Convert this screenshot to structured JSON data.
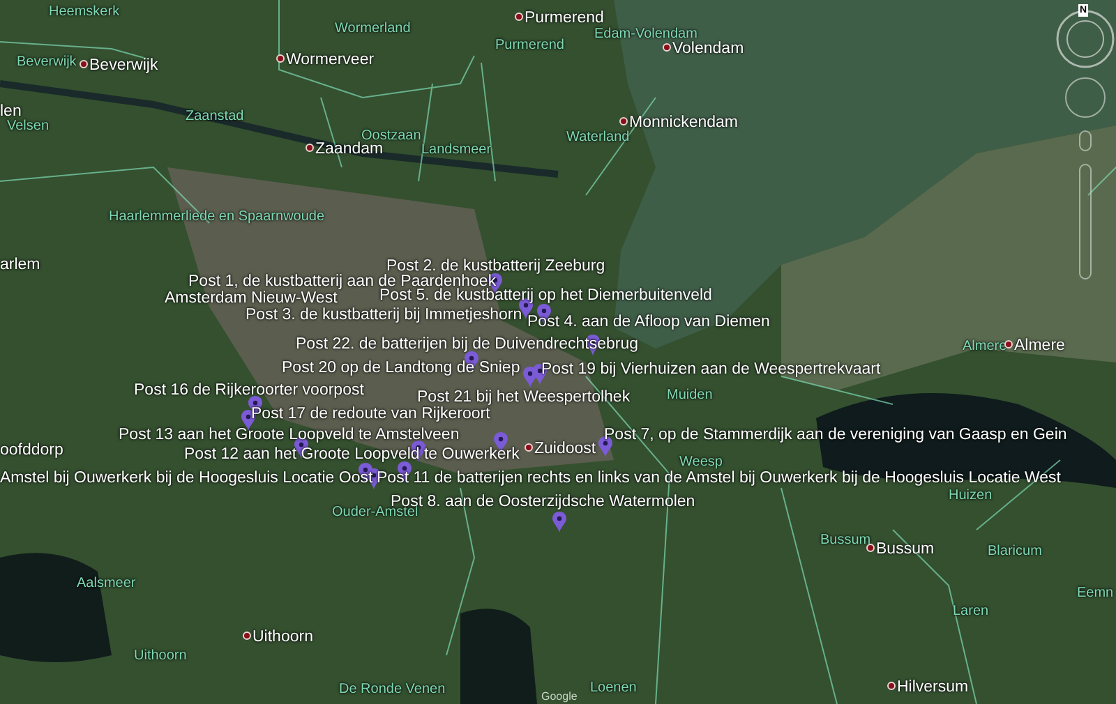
{
  "places": [
    {
      "name": "Heemskerk",
      "kind": "area"
    },
    {
      "name": "Beverwijk",
      "kind": "area"
    },
    {
      "name": "Beverwijk",
      "kind": "town"
    },
    {
      "name": "len",
      "kind": "town"
    },
    {
      "name": "Velsen",
      "kind": "area"
    },
    {
      "name": "Wormerland",
      "kind": "area"
    },
    {
      "name": "Wormerveer",
      "kind": "town"
    },
    {
      "name": "Purmerend",
      "kind": "town"
    },
    {
      "name": "Purmerend",
      "kind": "area"
    },
    {
      "name": "Edam-Volendam",
      "kind": "area"
    },
    {
      "name": "Volendam",
      "kind": "town"
    },
    {
      "name": "Zaanstad",
      "kind": "area"
    },
    {
      "name": "Zaandam",
      "kind": "town"
    },
    {
      "name": "Oostzaan",
      "kind": "area"
    },
    {
      "name": "Landsmeer",
      "kind": "area"
    },
    {
      "name": "Monnickendam",
      "kind": "town"
    },
    {
      "name": "Waterland",
      "kind": "area"
    },
    {
      "name": "Haarlemmerliede en Spaarnwoude",
      "kind": "area"
    },
    {
      "name": "arlem",
      "kind": "town"
    },
    {
      "name": "Amsterdam Nieuw-West",
      "kind": "label"
    },
    {
      "name": "Almere",
      "kind": "area"
    },
    {
      "name": "Almere",
      "kind": "town"
    },
    {
      "name": "Muiden",
      "kind": "area"
    },
    {
      "name": "Weesp",
      "kind": "area"
    },
    {
      "name": "oofddorp",
      "kind": "label"
    },
    {
      "name": "Zuidoost",
      "kind": "town"
    },
    {
      "name": "Ouder-Amstel",
      "kind": "area"
    },
    {
      "name": "Huizen",
      "kind": "area"
    },
    {
      "name": "Bussum",
      "kind": "area"
    },
    {
      "name": "Bussum",
      "kind": "town"
    },
    {
      "name": "Blaricum",
      "kind": "area"
    },
    {
      "name": "Laren",
      "kind": "area"
    },
    {
      "name": "Eemn",
      "kind": "area"
    },
    {
      "name": "Aalsmeer",
      "kind": "area"
    },
    {
      "name": "Uithoorn",
      "kind": "town"
    },
    {
      "name": "Uithoorn",
      "kind": "area"
    },
    {
      "name": "De Ronde Venen",
      "kind": "area"
    },
    {
      "name": "Loenen",
      "kind": "area"
    },
    {
      "name": "Hilversum",
      "kind": "town"
    }
  ],
  "posts": [
    {
      "label": "Post 2. de kustbatterij Zeeburg"
    },
    {
      "label": "Post 1, de kustbatterij aan de Paardenhoek"
    },
    {
      "label": "Post 5. de kustbatterij op het Diemerbuitenveld"
    },
    {
      "label": "Post 3. de kustbatterij bij Immetjeshorn"
    },
    {
      "label": "Post 4. aan de Afloop van Diemen"
    },
    {
      "label": "Post 22. de batterijen bij de Duivendrechtsebrug"
    },
    {
      "label": "Post 20 op de Landtong de Sniep"
    },
    {
      "label": "Post 19 bij Vierhuizen aan de Weespertrekvaart"
    },
    {
      "label": "Post 16 de Rijkeroorter voorpost"
    },
    {
      "label": "Post 21 bij het Weespertolhek"
    },
    {
      "label": "Post 17 de redoute van Rijkeroort"
    },
    {
      "label": "Post 13 aan het Groote Loopveld te Amstelveen"
    },
    {
      "label": "Post 7, op de Stammerdijk aan de vereniging van Gaasp en Gein"
    },
    {
      "label": "Post 12 aan het Groote Loopveld te Ouwerkerk"
    },
    {
      "label": "Amstel bij Ouwerkerk bij de Hoogesluis Locatie Oost"
    },
    {
      "label": "Post 11 de batterijen rechts en links van de Amstel bij Ouwerkerk bij de Hoogesluis Locatie West"
    },
    {
      "label": "Post 8. aan de Oosterzijdsche Watermolen"
    }
  ],
  "compass": {
    "label": "N"
  },
  "attribution": "Google"
}
